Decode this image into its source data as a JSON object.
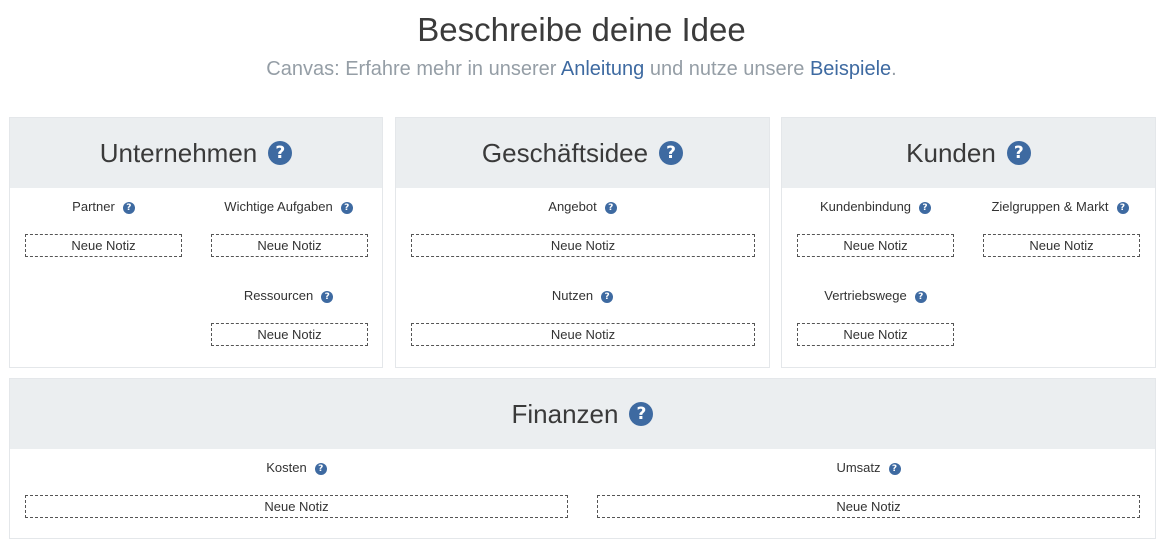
{
  "header": {
    "title": "Beschreibe deine Idee",
    "subtitle_prefix": "Canvas: Erfahre mehr in unserer ",
    "guide_link": "Anleitung",
    "subtitle_middle": " und nutze unsere ",
    "examples_link": "Beispiele",
    "subtitle_suffix": "."
  },
  "icons": {
    "help": "question-circle-icon",
    "help_glyph": "?"
  },
  "colors": {
    "accent": "#3e6aa1",
    "panel_header": "#ebeef0",
    "subtitle": "#959ea6"
  },
  "note_label": "Neue Notiz",
  "panels": {
    "unternehmen": {
      "title": "Unternehmen",
      "sections": {
        "partner": "Partner",
        "aufgaben": "Wichtige Aufgaben",
        "ressourcen": "Ressourcen"
      }
    },
    "geschaeftsidee": {
      "title": "Geschäftsidee",
      "sections": {
        "angebot": "Angebot",
        "nutzen": "Nutzen"
      }
    },
    "kunden": {
      "title": "Kunden",
      "sections": {
        "kundenbindung": "Kundenbindung",
        "zielgruppen": "Zielgruppen & Markt",
        "vertriebswege": "Vertriebswege"
      }
    },
    "finanzen": {
      "title": "Finanzen",
      "sections": {
        "kosten": "Kosten",
        "umsatz": "Umsatz"
      }
    }
  }
}
